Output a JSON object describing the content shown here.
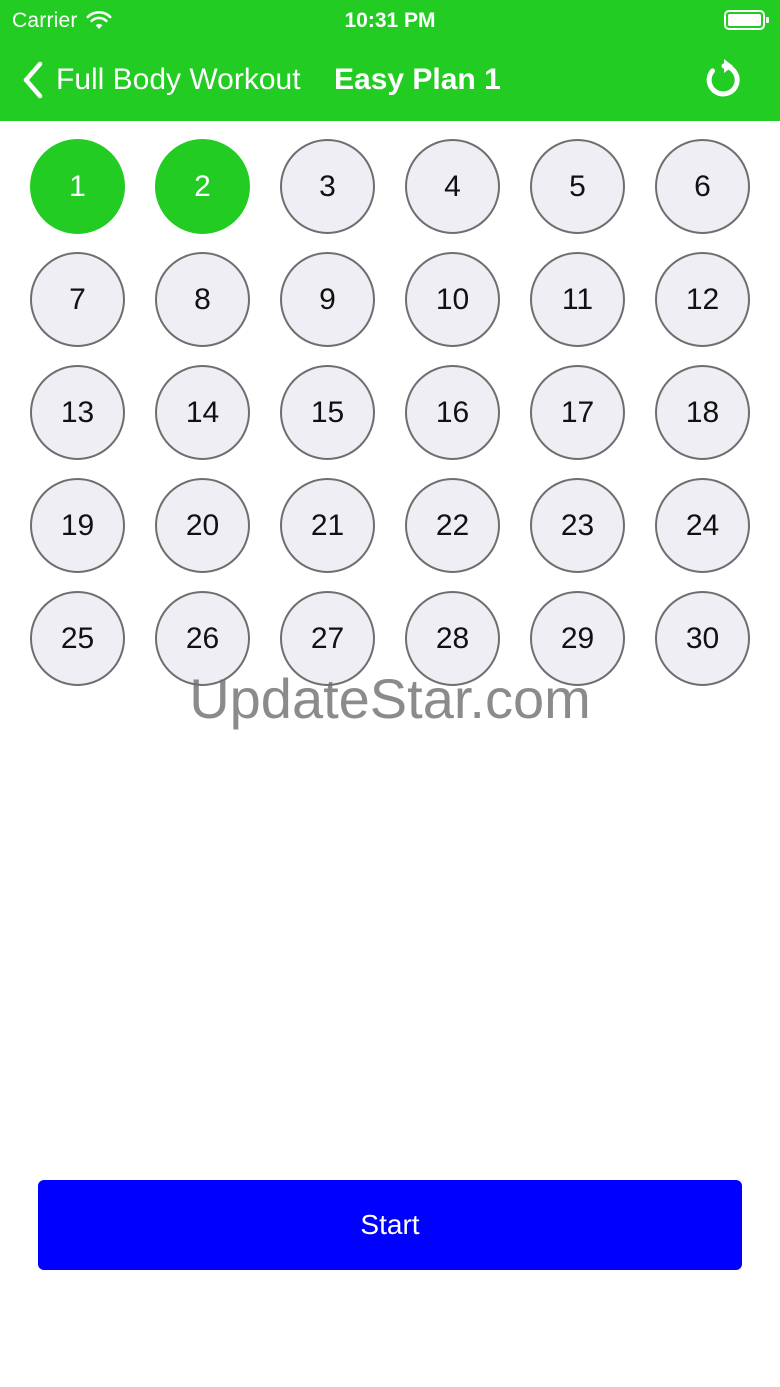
{
  "status_bar": {
    "carrier": "Carrier",
    "time": "10:31 PM",
    "icons": [
      "wifi-icon",
      "battery-icon"
    ]
  },
  "nav": {
    "back_label": "Full Body Workout",
    "title": "Easy Plan 1",
    "back_icon": "chevron-left-icon",
    "reset_icon": "refresh-icon"
  },
  "days": {
    "labels": [
      "1",
      "2",
      "3",
      "4",
      "5",
      "6",
      "7",
      "8",
      "9",
      "10",
      "11",
      "12",
      "13",
      "14",
      "15",
      "16",
      "17",
      "18",
      "19",
      "20",
      "21",
      "22",
      "23",
      "24",
      "25",
      "26",
      "27",
      "28",
      "29",
      "30"
    ],
    "completed": [
      "1",
      "2"
    ]
  },
  "watermark": "UpdateStar.com",
  "start_label": "Start",
  "colors": {
    "header_green": "#22cc22",
    "completed_green": "#22cc22",
    "day_fill": "#eeeef4",
    "day_border": "#6e6e6e",
    "start_blue": "#0000ff"
  }
}
